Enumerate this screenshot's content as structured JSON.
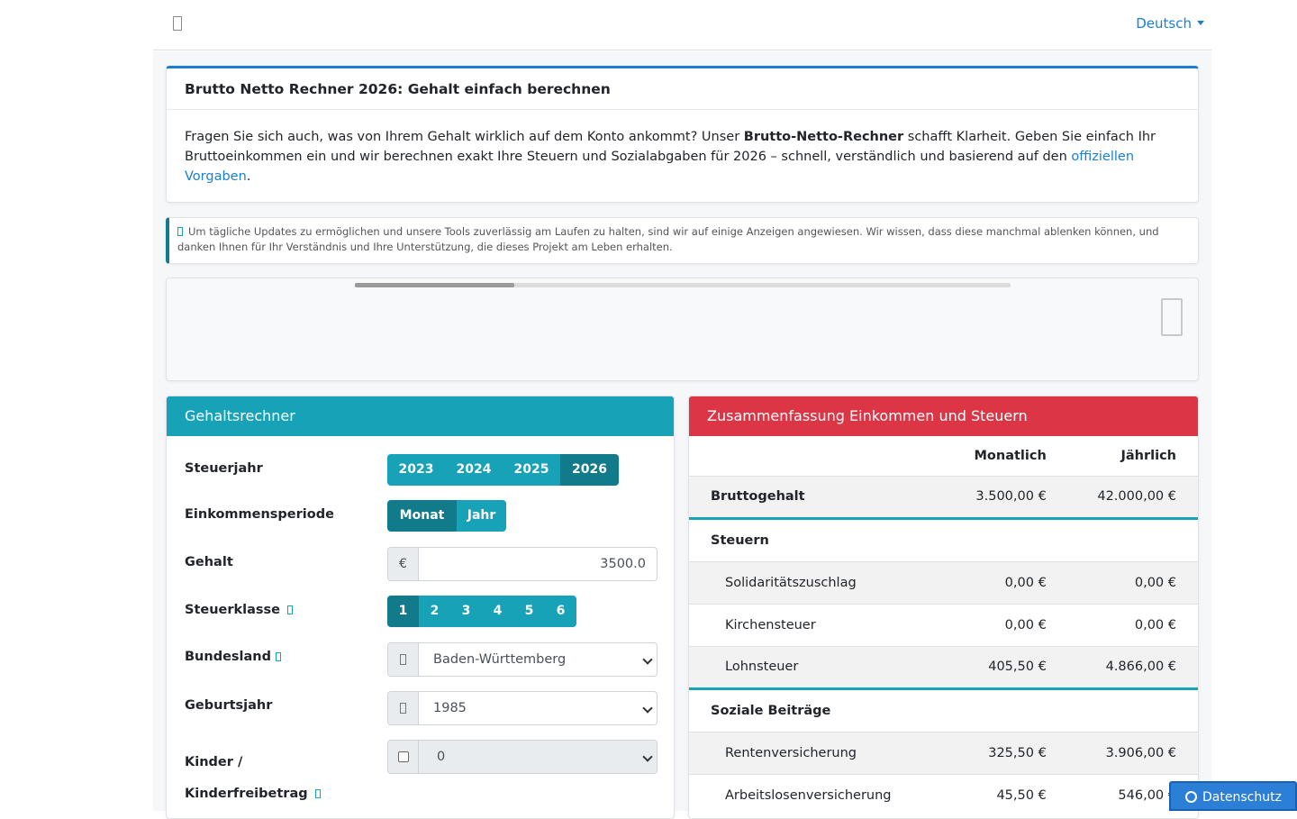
{
  "header": {
    "language": "Deutsch",
    "menu_icon": "menu-icon"
  },
  "intro": {
    "title": "Brutto Netto Rechner 2026: Gehalt einfach berechnen",
    "text_1": "Fragen Sie sich auch, was von Ihrem Gehalt wirklich auf dem Konto ankommt? Unser ",
    "text_bold": "Brutto-Netto-Rechner",
    "text_2": " schafft Klarheit. Geben Sie einfach Ihr Bruttoeinkommen ein und wir berechnen exakt Ihre Steuern und Sozialabgaben für 2026 – schnell, verständlich und basierend auf den ",
    "link": "offiziellen Vorgaben",
    "text_3": "."
  },
  "notice": {
    "text": "Um tägliche Updates zu ermöglichen und unsere Tools zuverlässig am Laufen zu halten, sind wir auf einige Anzeigen angewiesen. Wir wissen, dass diese manchmal ablenken können, und danken Ihnen für Ihr Verständnis und Ihre Unterstützung, die dieses Projekt am Leben erhalten."
  },
  "calculator": {
    "title": "Gehaltsrechner",
    "tax_year_label": "Steuerjahr",
    "tax_years": [
      "2023",
      "2024",
      "2025",
      "2026"
    ],
    "tax_year_selected": "2026",
    "period_label": "Einkommensperiode",
    "periods": [
      "Monat",
      "Jahr"
    ],
    "period_selected": "Monat",
    "salary_label": "Gehalt",
    "currency": "€",
    "salary_value": "3500.0",
    "tax_class_label": "Steuerklasse",
    "tax_classes": [
      "1",
      "2",
      "3",
      "4",
      "5",
      "6"
    ],
    "tax_class_selected": "1",
    "state_label": "Bundesland",
    "state_value": "Baden-Württemberg",
    "birth_year_label": "Geburtsjahr",
    "birth_year_value": "1985",
    "children_label_1": "Kinder /",
    "children_label_2": "Kinderfreibetrag",
    "children_value": "0"
  },
  "summary": {
    "title": "Zusammenfassung Einkommen und Steuern",
    "col_monthly": "Monatlich",
    "col_yearly": "Jährlich",
    "gross": {
      "label": "Bruttogehalt",
      "monthly": "3.500,00 €",
      "yearly": "42.000,00 €"
    },
    "taxes_label": "Steuern",
    "taxes": [
      {
        "label": "Solidaritätszuschlag",
        "monthly": "0,00 €",
        "yearly": "0,00 €"
      },
      {
        "label": "Kirchensteuer",
        "monthly": "0,00 €",
        "yearly": "0,00 €"
      },
      {
        "label": "Lohnsteuer",
        "monthly": "405,50 €",
        "yearly": "4.866,00 €"
      }
    ],
    "social_label": "Soziale Beiträge",
    "social": [
      {
        "label": "Rentenversicherung",
        "monthly": "325,50 €",
        "yearly": "3.906,00 €"
      },
      {
        "label": "Arbeitslosenversicherung",
        "monthly": "45,50 €",
        "yearly": "546,00 €"
      }
    ]
  },
  "cookie_button": "Datenschutz",
  "colors": {
    "calc_header": "#17a2b8",
    "summary_header": "#dc3545",
    "link": "#1a7fd4"
  }
}
